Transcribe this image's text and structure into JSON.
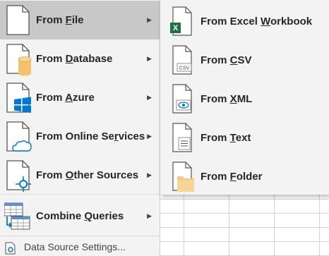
{
  "menu": {
    "items": [
      {
        "pre": "From ",
        "key": "F",
        "post": "ile",
        "icon": "file-icon",
        "active": true,
        "has_submenu": true
      },
      {
        "pre": "From ",
        "key": "D",
        "post": "atabase",
        "icon": "database-icon",
        "has_submenu": true
      },
      {
        "pre": "From ",
        "key": "A",
        "post": "zure",
        "icon": "azure-icon",
        "has_submenu": true
      },
      {
        "pre": "From Online Se",
        "key": "r",
        "post": "vices",
        "icon": "online-services-icon",
        "has_submenu": true
      },
      {
        "pre": "From ",
        "key": "O",
        "post": "ther Sources",
        "icon": "other-sources-icon",
        "has_submenu": true
      },
      {
        "pre": "Combine ",
        "key": "Q",
        "post": "ueries",
        "icon": "combine-queries-icon",
        "has_submenu": true
      }
    ],
    "arrow": "▶",
    "settings_label": "Data Source Settings..."
  },
  "submenu": {
    "items": [
      {
        "pre": "From Excel ",
        "key": "W",
        "post": "orkbook",
        "icon": "excel-workbook-icon"
      },
      {
        "pre": "From ",
        "key": "C",
        "post": "SV",
        "icon": "csv-icon",
        "badge": "CSV"
      },
      {
        "pre": "From ",
        "key": "X",
        "post": "ML",
        "icon": "xml-icon"
      },
      {
        "pre": "From ",
        "key": "T",
        "post": "ext",
        "icon": "text-file-icon"
      },
      {
        "pre": "From ",
        "key": "F",
        "post": "older",
        "icon": "folder-icon"
      }
    ]
  },
  "colors": {
    "menu_bg": "#f3f3f3",
    "active_bg": "#c8c8c8",
    "excel_green": "#1e7145",
    "azure_blue": "#0078d4",
    "database_gold": "#f3c26b",
    "folder_tan": "#f1c981"
  }
}
